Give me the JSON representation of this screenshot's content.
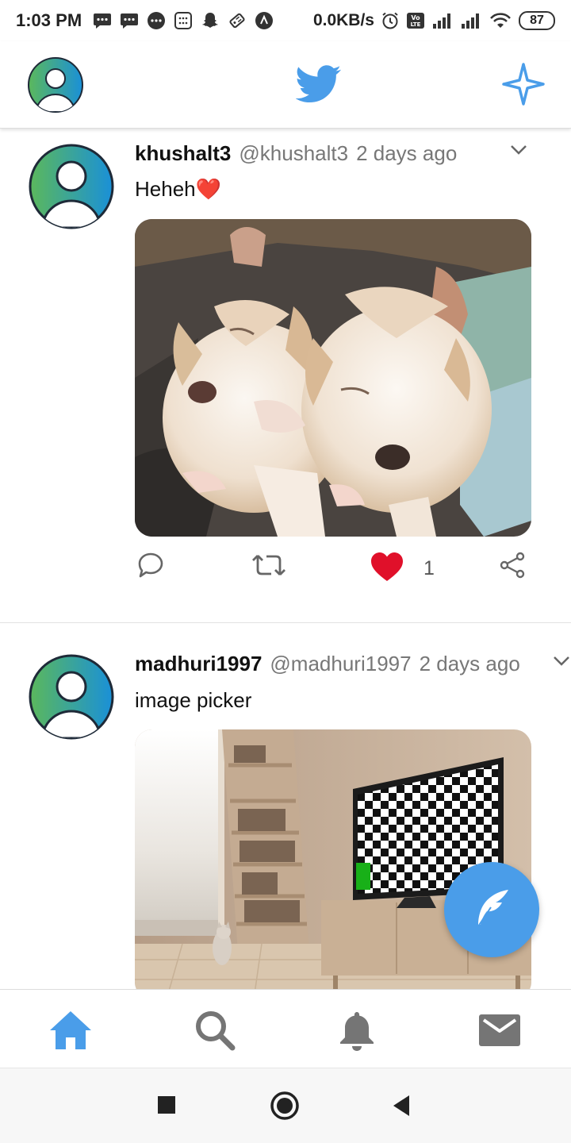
{
  "status_bar": {
    "time": "1:03 PM",
    "network_speed": "0.0KB/s",
    "battery": "87",
    "icons": [
      "message-icon",
      "message-icon",
      "chat-icon",
      "calculator-icon",
      "snapchat-icon",
      "tag-icon",
      "app-icon",
      "alarm-icon",
      "volte-icon",
      "signal-icon",
      "signal-icon",
      "wifi-icon",
      "battery-icon"
    ]
  },
  "app_bar": {
    "avatar_icon": "profile-avatar-icon",
    "logo_icon": "twitter-bird-icon",
    "action_icon": "sparkle-icon"
  },
  "tweets": [
    {
      "name": "khushalt3",
      "handle": "@khushalt3",
      "time": "2 days ago",
      "text": "Heheh❤️",
      "image_icon": "puppies-photo",
      "like_count": "1",
      "liked": true
    },
    {
      "name": "madhuri1997",
      "handle": "@madhuri1997",
      "time": "2 days ago",
      "text": "image picker",
      "image_icon": "room-photo"
    }
  ],
  "bottom_nav": {
    "items": [
      "home-icon",
      "search-icon",
      "notifications-icon",
      "messages-icon"
    ],
    "active": "home-icon"
  },
  "colors": {
    "brand_blue": "#4a9de9",
    "like_red": "#e0102a",
    "icon_gray": "#757575"
  }
}
